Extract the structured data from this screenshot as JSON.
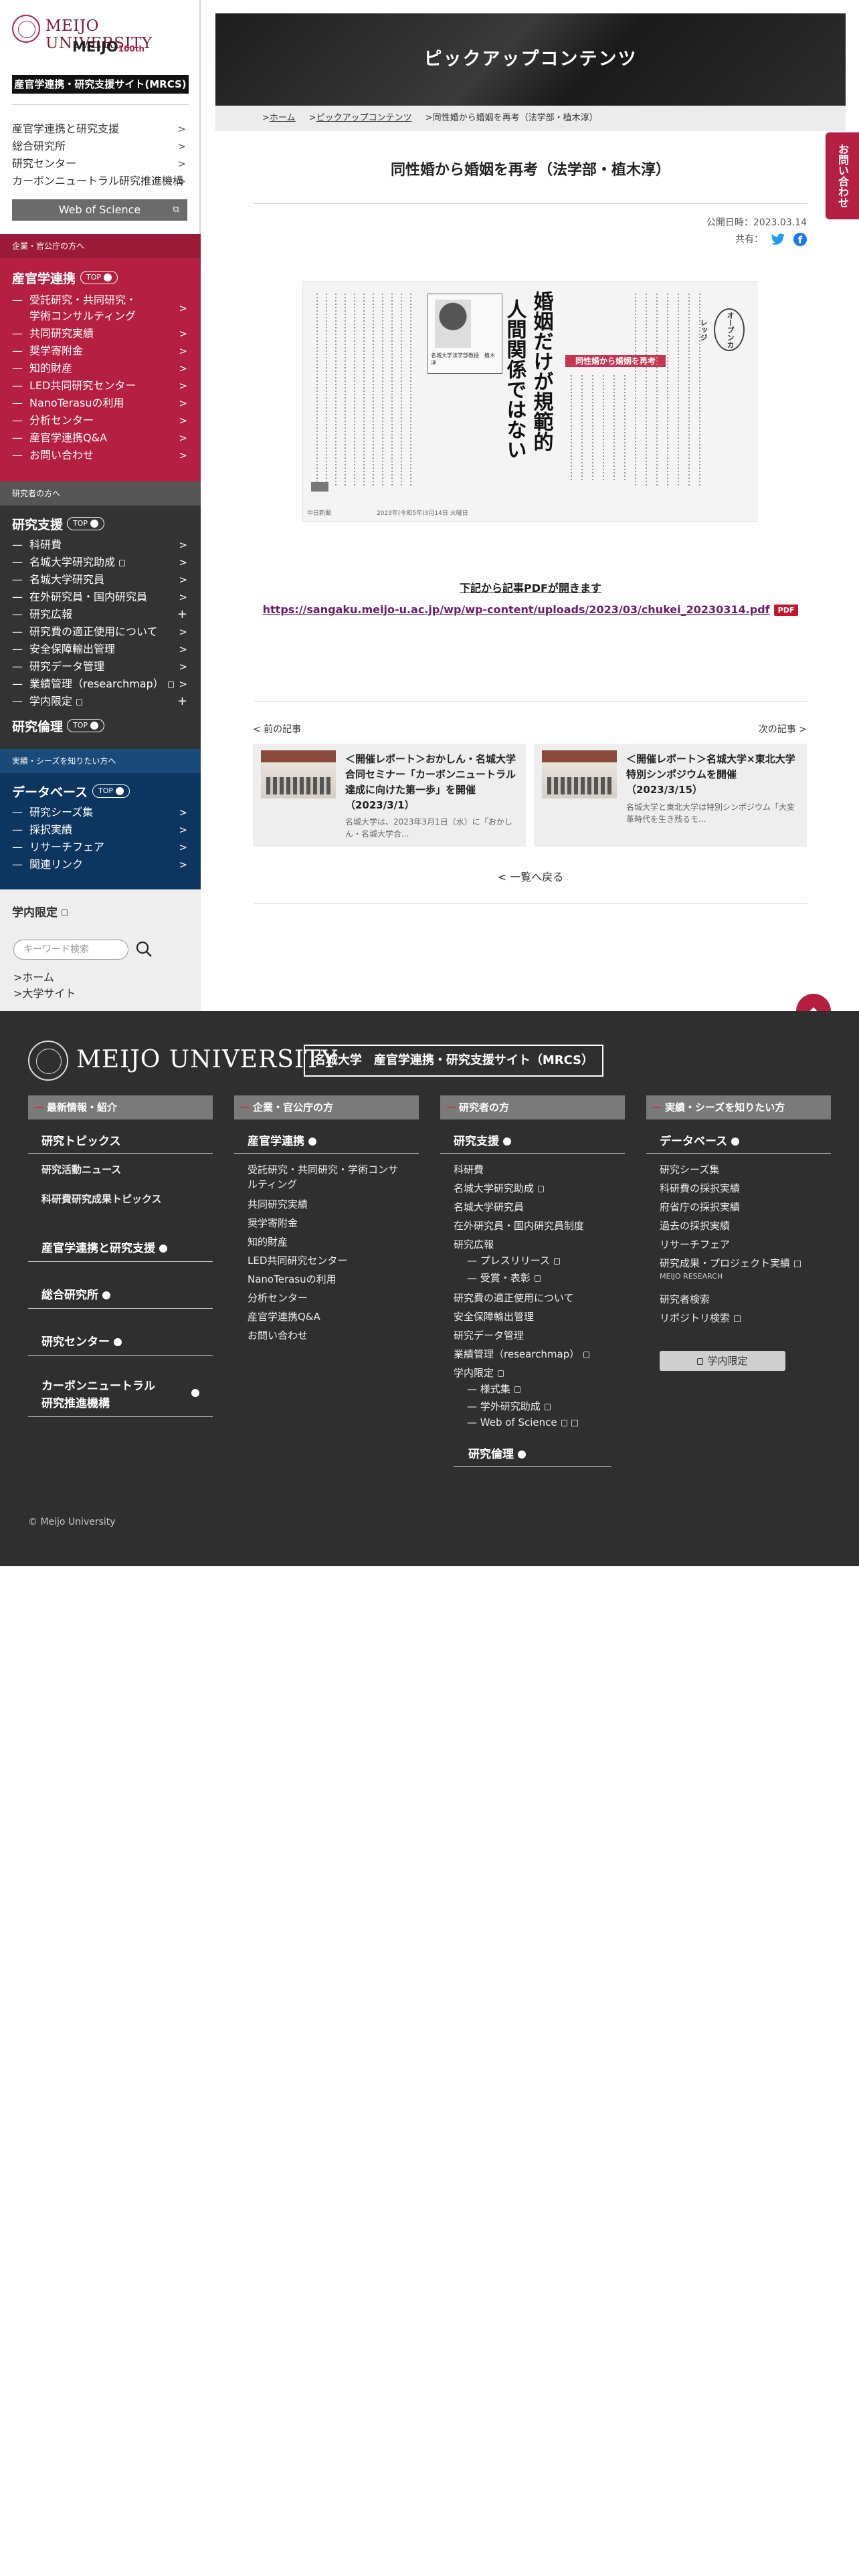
{
  "brand": {
    "university": "MEIJO UNIVERSITY",
    "anniv": "MEIJO",
    "anniv_num": "100th",
    "site_badge": "産官学連携・研究支援サイト(MRCS)"
  },
  "sidebar": {
    "top_nav": [
      "産官学連携と研究支援",
      "総合研究所",
      "研究センター",
      "カーボンニュートラル研究推進機構"
    ],
    "wos_label": "Web of Science",
    "band1_head": "企業・官公庁の方へ",
    "band1_title": "産官学連携",
    "band1_items": [
      "受託研究・共同研究・",
      "学術コンサルティング",
      "共同研究実績",
      "奨学寄附金",
      "知的財産",
      "LED共同研究センター",
      "NanoTerasuの利用",
      "分析センター",
      "産官学連携Q&A",
      "お問い合わせ"
    ],
    "band2_head": "研究者の方へ",
    "band2_title": "研究支援",
    "band2_items": [
      "科研費",
      "名城大学研究助成",
      "名城大学研究員",
      "在外研究員・国内研究員",
      "研究広報",
      "研究費の適正使用について",
      "安全保障輸出管理",
      "研究データ管理",
      "業績管理（researchmap）",
      "学内限定"
    ],
    "band2_title2": "研究倫理",
    "band3_head": "実績・シーズを知りたい方へ",
    "band3_title": "データベース",
    "band3_items": [
      "研究シーズ集",
      "採択実績",
      "リサーチフェア",
      "関連リンク"
    ],
    "top_tag": "TOP",
    "gakunai": "学内限定",
    "search_placeholder": "キーワード検索",
    "home": ">ホーム",
    "univ_site": ">大学サイト"
  },
  "hero": {
    "title": "ピックアップコンテンツ"
  },
  "breadcrumb": [
    "ホーム",
    "ピックアップコンテンツ",
    "同性婚から婚姻を再考（法学部・植木淳）"
  ],
  "contact_tab": "お問い合わせ",
  "article": {
    "title": "同性婚から婚姻を再考（法学部・植木淳）",
    "pubdate": "公開日時：2023.03.14",
    "share": "共有：",
    "clipping_headline": "婚姻だけが規範的",
    "clipping_headline2": "人間関係ではない",
    "clipping_red": "同性婚から婚姻を再考",
    "clipping_badge": "オープンカレッジ",
    "clipping_author": "名城大学法学部教授　植木　淳",
    "clipping_footer": "2023年(令和5年)3月14日 火曜日",
    "clipping_source": "中日新聞",
    "pdf_caption": "下記から記事PDFが開きます",
    "pdf_url": "https://sangaku.meijo-u.ac.jp/wp/wp-content/uploads/2023/03/chukei_20230314.pdf",
    "pdf_badge": "PDF"
  },
  "pager": {
    "prev_label": "< 前の記事",
    "next_label": "次の記事 >",
    "prev": {
      "title": "＜開催レポート＞おかしん・名城大学合同セミナー「カーボンニュートラル達成に向けた第一歩」を開催（2023/3/1）",
      "excerpt": "名城大学は、2023年3月1日（水）に「おかしん・名城大学合..."
    },
    "next": {
      "title": "＜開催レポート＞名城大学×東北大学 特別シンポジウムを開催（2023/3/15）",
      "excerpt": "名城大学と東北大学は特別シンポジウム「大変革時代を生き残るモ..."
    },
    "back": "< 一覧へ戻る"
  },
  "footer": {
    "logo": "MEIJO UNIVERSITY",
    "site": "名城大学　産官学連携・研究支援サイト（MRCS）",
    "col1_head": "最新情報・紹介",
    "col1": {
      "h1": "研究トピックス",
      "l1": "研究活動ニュース",
      "l2": "科研費研究成果トピックス",
      "h2": "産官学連携と研究支援",
      "h3": "総合研究所",
      "h4": "研究センター",
      "h5a": "カーボンニュートラル",
      "h5b": "研究推進機構"
    },
    "col2_head": "企業・官公庁の方",
    "col2": {
      "h": "産官学連携",
      "items": [
        "受託研究・共同研究・学術コンサ",
        "ルティング",
        "共同研究実績",
        "奨学寄附金",
        "知的財産",
        "LED共同研究センター",
        "NanoTerasuの利用",
        "分析センター",
        "産官学連携Q&A",
        "お問い合わせ"
      ]
    },
    "col3_head": "研究者の方",
    "col3": {
      "h": "研究支援",
      "items": [
        "科研費",
        "名城大学研究助成",
        "名城大学研究員",
        "在外研究員・国内研究員制度",
        "研究広報",
        "— プレスリリース",
        "— 受賞・表彰",
        "研究費の適正使用について",
        "安全保障輸出管理",
        "研究データ管理",
        "業績管理（researchmap）",
        "学内限定",
        "— 様式集",
        "— 学外研究助成",
        "— Web of Science"
      ],
      "h2": "研究倫理"
    },
    "col4_head": "実績・シーズを知りたい方",
    "col4": {
      "h": "データベース",
      "items": [
        "研究シーズ集",
        "科研費の採択実績",
        "府省庁の採択実績",
        "過去の採択実績",
        "リサーチフェア",
        "研究成果・プロジェクト実績",
        "MEIJO RESEARCH",
        "研究者検索",
        "リポジトリ検索"
      ],
      "gakunai": "学内限定"
    },
    "copyright": "© Meijo University"
  },
  "colors": {
    "accent": "#b52042",
    "band1": "#b52042",
    "band2": "#333333",
    "band3": "#0c3560",
    "footer": "#2f2f2f"
  },
  "icons": [
    "search-icon",
    "chevron-right-icon",
    "lock-icon",
    "external-link-icon",
    "twitter-icon",
    "facebook-icon",
    "pdf-icon",
    "page-top-icon"
  ]
}
